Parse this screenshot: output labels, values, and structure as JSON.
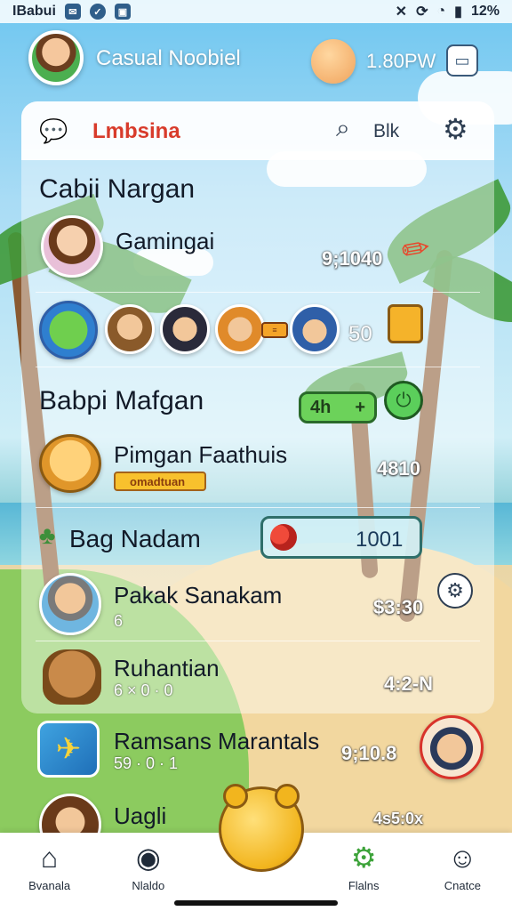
{
  "status": {
    "left_text": "IBabui",
    "right_text": "12%",
    "battery_percent": "12%"
  },
  "header": {
    "title": "Casual Noobiel",
    "coin_value": "1.80PW"
  },
  "search": {
    "title": "Lmbsina",
    "right_text": "Blk"
  },
  "sections": [
    {
      "title": "Cabii Nargan"
    },
    {
      "title": "Babpi Mafgan"
    },
    {
      "title": "Bag Nadam"
    }
  ],
  "rows": [
    {
      "name": "Gamingai",
      "value": "9;1040"
    },
    {
      "name": "Pimgan Faathuis",
      "value": "4810",
      "badge": "omadtuan"
    },
    {
      "name": "Pakak Sanakam",
      "value": "$3:30",
      "sub": "6"
    },
    {
      "name": "Ruhantian",
      "value": "4:2-N",
      "sub": "6 × 0 · 0"
    },
    {
      "name": "Ramsans Marantals",
      "value": "9;10.8",
      "sub": "59 · 0 · 1"
    },
    {
      "name": "Uagli",
      "value": "4s5:0x"
    }
  ],
  "group": {
    "level": "50"
  },
  "add_pill": {
    "value": "4h",
    "plus": "+"
  },
  "highlight": {
    "value": "1001"
  },
  "nav": [
    {
      "label": "Bvanala",
      "icon": "home-icon"
    },
    {
      "label": "Nlaldo",
      "icon": "chat-icon"
    },
    {
      "label": "",
      "icon": "mascot-icon"
    },
    {
      "label": "Flalns",
      "icon": "gear-icon"
    },
    {
      "label": "Cnatce",
      "icon": "profile-icon"
    }
  ]
}
